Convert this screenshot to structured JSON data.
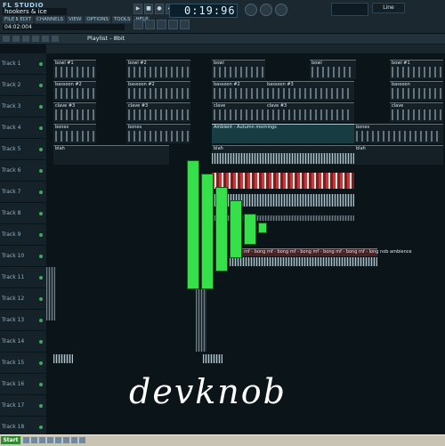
{
  "app": {
    "logo": "FL STUDIO",
    "song_title": "hookers & ice cream",
    "hint": "04:02:004"
  },
  "menu": [
    "FILE",
    "EDIT",
    "CHANNELS",
    "VIEW",
    "OPTIONS",
    "TOOLS",
    "HELP"
  ],
  "clock": {
    "time": "0:19:96"
  },
  "tempo": "Line",
  "playlist": {
    "title": "Playlist - 8bit"
  },
  "tracks": [
    "Track 1",
    "Track 2",
    "Track 3",
    "Track 4",
    "Track 5",
    "Track 6",
    "Track 7",
    "Track 8",
    "Track 9",
    "Track 10",
    "Track 11",
    "Track 12",
    "Track 13",
    "Track 14",
    "Track 15",
    "Track 16",
    "Track 17",
    "Track 18"
  ],
  "clips": {
    "t1a": "bowl #1",
    "t1b": "bowl #2",
    "t1c": "bowl",
    "t1d": "bowl",
    "t1e": "bowl #1",
    "t2a": "bassoon #2",
    "t2b": "bassoon #2",
    "t2c": "bassoon #2",
    "t2d": "bassoon #3",
    "t2e": "bassoon",
    "t3a": "clave #3",
    "t3b": "clave #3",
    "t3c": "clave",
    "t3d": "clave #3",
    "t3e": "clave",
    "t4a": "bones",
    "t4b": "bones",
    "t4c": "Ambient - Autumn mornings",
    "t4d": "bones",
    "t5a": "blah",
    "t5b": "blah",
    "t5c": "blah",
    "t10a": "bong mf - bong mf - bong mf - bong mf - bong mf - bong mf - long nob ambience"
  },
  "watermark": "devknob",
  "taskbar": {
    "start": "Start"
  }
}
